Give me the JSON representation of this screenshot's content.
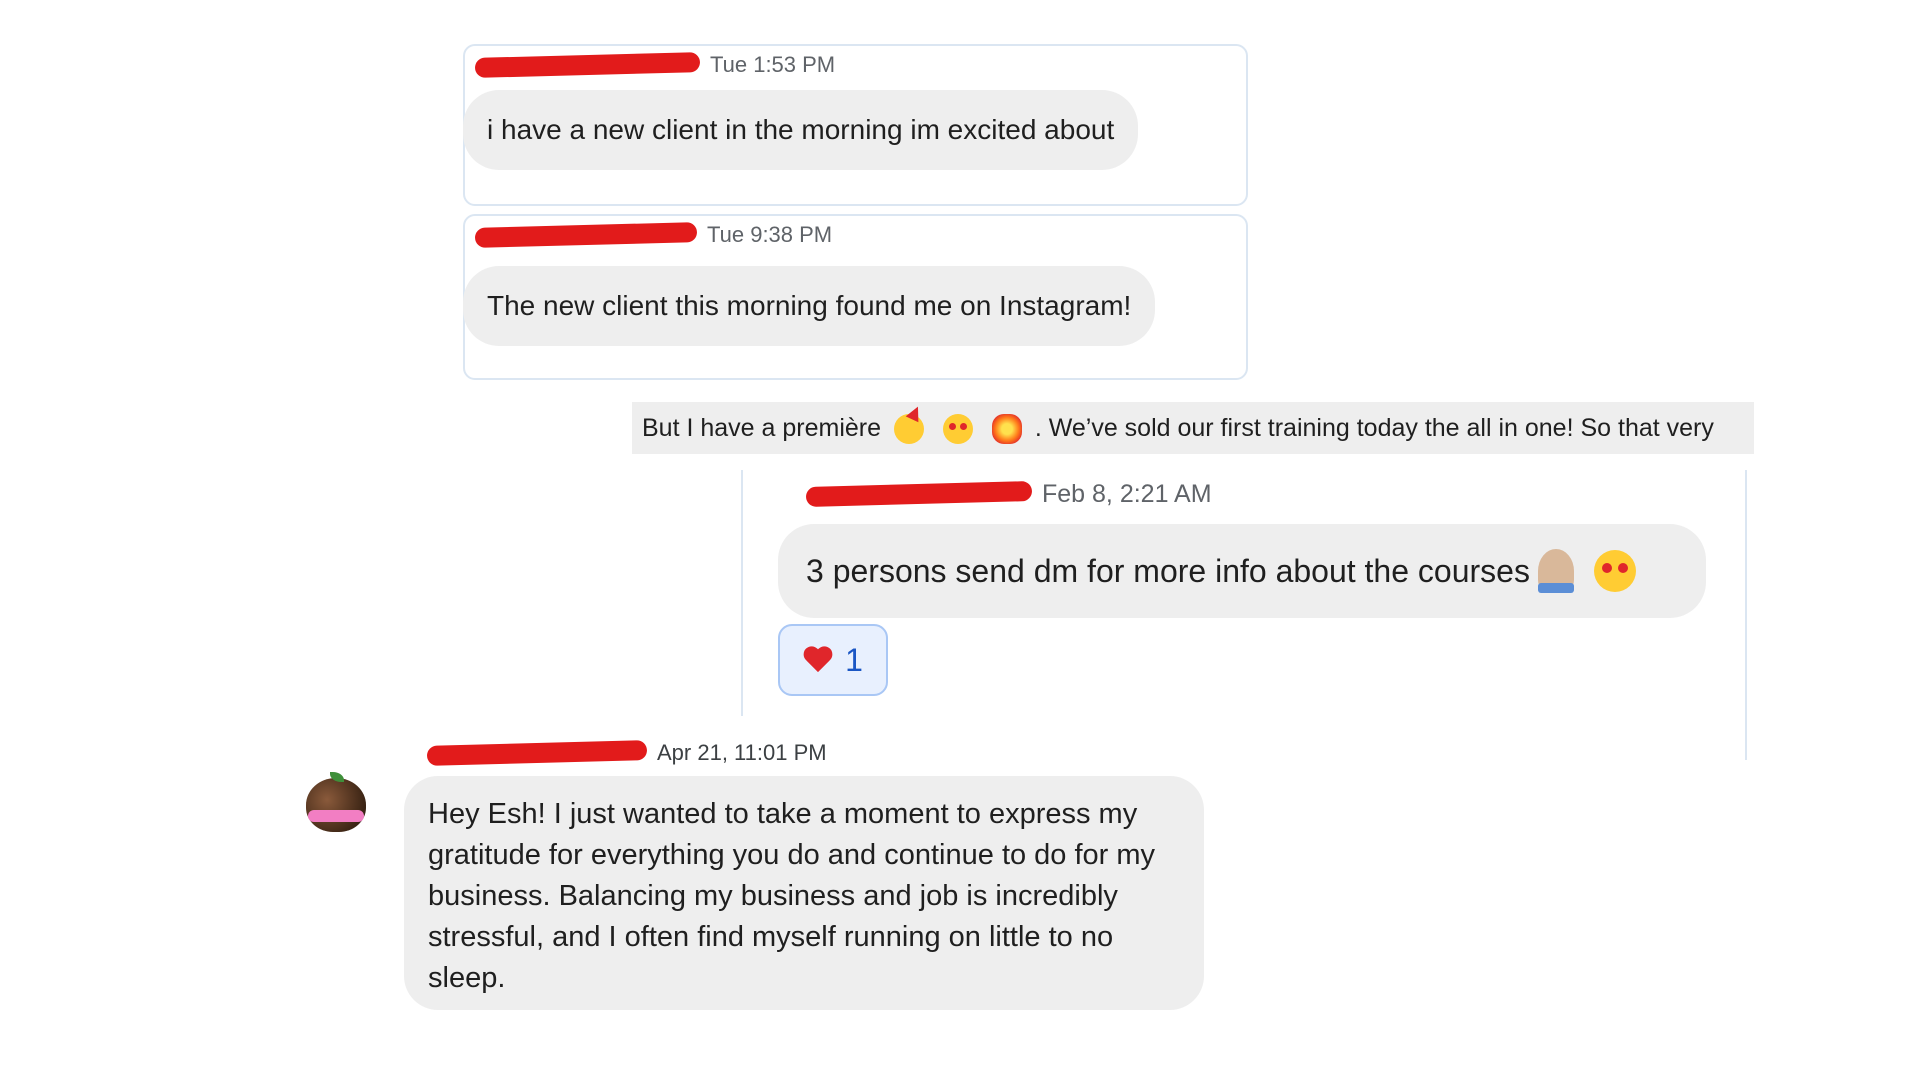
{
  "messages": [
    {
      "time": "Tue 1:53 PM",
      "text": "i have a new client in the morning im excited about"
    },
    {
      "time": "Tue 9:38 PM",
      "text": "The new client this morning found me on Instagram!"
    },
    {
      "text_before": "But I have a première",
      "text_after": ". We’ve sold our first training today the all in one! So that very",
      "emoji": [
        "partying-face",
        "star-struck",
        "collision"
      ]
    },
    {
      "time": "Feb 8, 2:21 AM",
      "text": "3 persons send dm for more info about the courses",
      "emoji": [
        "folded-hands-medium-light-skin",
        "star-struck"
      ],
      "reaction": {
        "emoji": "red-heart",
        "count": "1"
      }
    },
    {
      "time": "Apr 21, 11:01 PM",
      "text": "Hey Esh! I just wanted to take a moment to express my gratitude for everything you do and continue to do for my business. Balancing my business and job is incredibly stressful, and I often find myself running on little to no sleep.",
      "avatar": "peach-logo-avatar"
    }
  ],
  "colors": {
    "bubble": "#eeeeee",
    "card_border": "#dbe6f2",
    "redaction": "#e21b1b",
    "reaction_bg": "#e8f0fe",
    "reaction_border": "#a9c7f5",
    "timestamp": "#5f6368"
  }
}
